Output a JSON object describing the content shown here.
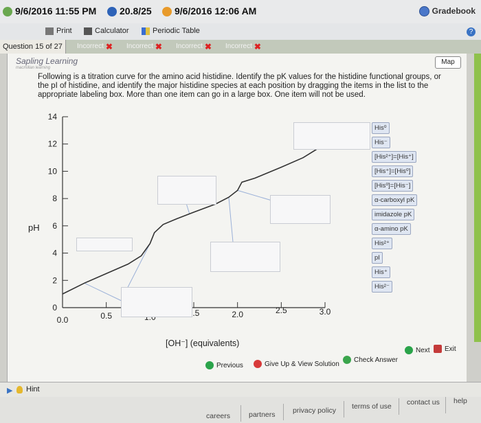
{
  "topbar": {
    "start_time": "9/6/2016 11:55 PM",
    "score": "20.8/25",
    "due_time": "9/6/2016 12:06 AM",
    "gradebook_label": "Gradebook"
  },
  "toolbar": {
    "print_label": "Print",
    "calculator_label": "Calculator",
    "periodic_table_label": "Periodic Table"
  },
  "question_strip": {
    "question_label": "Question 15 of 27",
    "attempts": [
      "Incorrect",
      "Incorrect",
      "Incorrect",
      "Incorrect"
    ]
  },
  "content": {
    "publisher_name": "Sapling Learning",
    "publisher_tagline": "macmillan learning",
    "map_label": "Map",
    "question_text": "Following is a titration curve for the amino acid histidine. Identify the pK values for the histidine functional groups, or the pI of histidine, and identify the major histidine species at each position by dragging the items in the list to the appropriate labeling box. More than one item can go in a large box. One item will not be used."
  },
  "chart_data": {
    "type": "line",
    "ylabel": "pH",
    "xlabel": "[OH⁻] (equivalents)",
    "ylim": [
      0,
      14
    ],
    "xlim": [
      0,
      3.0
    ],
    "y_ticks": [
      "0",
      "2",
      "4",
      "6",
      "8",
      "10",
      "12",
      "14"
    ],
    "x_ticks": [
      "0.0",
      "0.5",
      "1.0",
      "1.5",
      "2.0",
      "2.5",
      "3.0"
    ],
    "series": [
      {
        "x": [
          0.0,
          0.25,
          0.5,
          0.75,
          0.9,
          1.0,
          1.05,
          1.15,
          1.3,
          1.5,
          1.75,
          1.9,
          2.0,
          2.05,
          2.2,
          2.5,
          2.75,
          2.9,
          3.0
        ],
        "y": [
          1.0,
          1.8,
          2.5,
          3.2,
          3.8,
          4.7,
          5.5,
          6.1,
          6.5,
          7.0,
          7.6,
          8.1,
          8.6,
          9.2,
          9.5,
          10.3,
          11.0,
          11.6,
          12.3
        ]
      }
    ]
  },
  "drag_items": [
    "His⁰",
    "His⁻",
    "[His²⁺]=[His⁺]",
    "[His⁺]=[His⁰]",
    "[His⁰]=[His⁻]",
    "α-carboxyl pK",
    "imidazole pK",
    "α-amino pK",
    "His²⁺",
    "pI",
    "His⁺",
    "His²⁻"
  ],
  "nav": {
    "previous_label": "Previous",
    "give_up_label": "Give Up & View Solution",
    "check_answer_label": "Check Answer",
    "next_label": "Next",
    "exit_label": "Exit"
  },
  "hint_label": "Hint",
  "footer": {
    "links": [
      "careers",
      "partners",
      "privacy policy",
      "terms of use",
      "contact us",
      "help"
    ]
  },
  "colors": {
    "scroll_green": "#8fc14c",
    "curve": "#333333",
    "leader_lines": "#9ab0d8"
  }
}
